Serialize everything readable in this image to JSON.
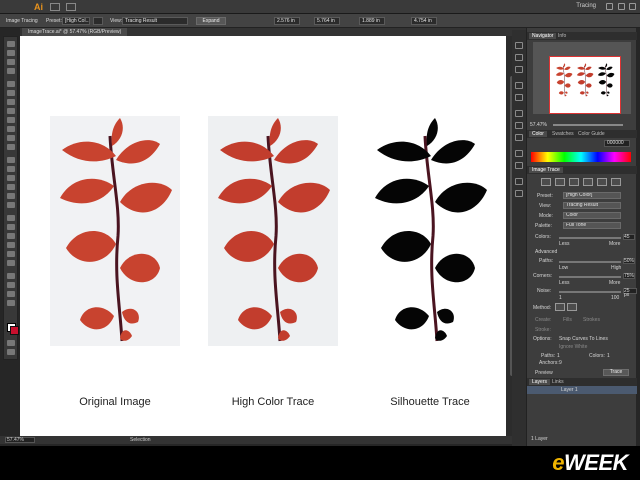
{
  "app": {
    "logo": "Ai",
    "workspace": "Tracing"
  },
  "control_bar": {
    "panel_name": "Image Tracing",
    "preset_label": "Preset:",
    "preset_value": "[High Col...",
    "view_label": "View:",
    "view_value": "Tracing Result",
    "expand_button": "Expand",
    "x_value": "2.576 in",
    "y_value": "5.764 in",
    "w_value": "1.889 in",
    "h_value": "4.754 in"
  },
  "document": {
    "tab_title": "ImageTrace.ai* @ 57.47% (RGB/Preview)"
  },
  "canvas": {
    "panels": [
      {
        "label": "Original Image",
        "style": "color"
      },
      {
        "label": "High Color Trace",
        "style": "color"
      },
      {
        "label": "Silhouette Trace",
        "style": "silhouette"
      }
    ]
  },
  "status_bar": {
    "zoom": "57.47%",
    "tool": "Selection"
  },
  "navigator": {
    "tabs": [
      "Navigator",
      "Info"
    ],
    "zoom": "57.47%"
  },
  "color_panel": {
    "tabs": [
      "Color",
      "Swatches",
      "Color Guide"
    ],
    "hex": "000000"
  },
  "image_trace": {
    "title": "Image Trace",
    "preset_label": "Preset:",
    "preset_value": "[High Color]",
    "view_label": "View:",
    "view_value": "Tracing Result",
    "mode_label": "Mode:",
    "mode_value": "Color",
    "palette_label": "Palette:",
    "palette_value": "Full Tone",
    "colors_label": "Colors:",
    "colors_value": "45",
    "less_label": "Less",
    "more_label": "More",
    "advanced_label": "Advanced",
    "paths_label": "Paths:",
    "paths_value": "50%",
    "low_label": "Low",
    "high_label": "High",
    "corners_label": "Corners:",
    "corners_value": "75%",
    "noise_label": "Noise:",
    "noise_value": "25 px",
    "noise_min": "1",
    "noise_max": "100",
    "method_label": "Method:",
    "create_label": "Create:",
    "fills_label": "Fills",
    "strokes_label": "Strokes",
    "stroke_label": "Stroke:",
    "options_label": "Options:",
    "snap_curves": "Snap Curves To Lines",
    "ignore_white": "Ignore White",
    "stats_paths_label": "Paths:",
    "stats_paths_value": "1",
    "stats_colors_label": "Colors:",
    "stats_colors_value": "1",
    "stats_anchors_label": "Anchors:",
    "stats_anchors_value": "9",
    "preview_label": "Preview",
    "trace_button": "Trace"
  },
  "layers": {
    "tabs": [
      "Layers",
      "Links"
    ],
    "layer_name": "Layer 1",
    "count": "1 Layer"
  },
  "caption": {
    "brand_e": "e",
    "brand_rest": "WEEK"
  },
  "colors": {
    "accent": "#e8931d",
    "stroke_swatch": "#c8102e",
    "panel": "#3d3d3d"
  },
  "icons": [
    "ai-logo",
    "bridge-icon",
    "arrange-icon",
    "close-icon",
    "gear-icon",
    "trace-preset-icon"
  ]
}
